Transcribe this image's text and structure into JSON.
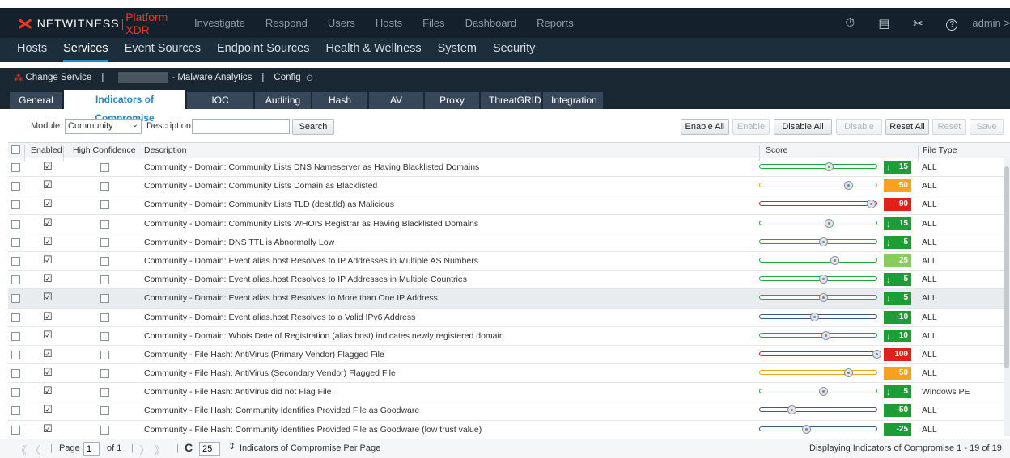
{
  "brand": {
    "name": "NETWITNESS",
    "separator": "|",
    "product": "Platform XDR"
  },
  "top_nav": [
    "Investigate",
    "Respond",
    "Users",
    "Hosts",
    "Files",
    "Dashboard",
    "Reports"
  ],
  "top_icons": {
    "timer": "⏱",
    "doc": "▤",
    "tools": "✂",
    "help": "?"
  },
  "admin_label": "admin >",
  "sec_nav": [
    "Hosts",
    "Services",
    "Event Sources",
    "Endpoint Sources",
    "Health & Wellness",
    "System",
    "Security"
  ],
  "service_bar": {
    "change_service": "Change Service",
    "pipe": "|",
    "service_name": "- Malware Analytics",
    "pipe2": "|",
    "config": "Config",
    "config_icon": "⊙"
  },
  "tabs": [
    "General",
    "Indicators of Compromise",
    "IOC Summary",
    "Auditing",
    "Hash",
    "AV",
    "Proxy",
    "ThreatGRID",
    "Integration"
  ],
  "toolbar": {
    "module_label": "Module",
    "module_value": "Community",
    "description_label": "Description",
    "description_value": "",
    "search": "Search",
    "enable_all": "Enable All",
    "enable": "Enable",
    "disable_all": "Disable All",
    "disable": "Disable",
    "reset_all": "Reset All",
    "reset": "Reset",
    "save": "Save"
  },
  "columns": {
    "enabled": "Enabled",
    "high_confidence": "High Confidence",
    "description": "Description",
    "score": "Score",
    "file_type": "File Type"
  },
  "colors": {
    "green": "#1fa83a",
    "light_green": "#8acc5c",
    "orange": "#f7a120",
    "red": "#e0201a",
    "dark_green": "#1d9d36"
  },
  "rows": [
    {
      "description": "Community - Domain: Community Lists DNS Nameserver as Having Blacklisted Domains",
      "score": 15,
      "score_text": "15",
      "arrow": "↓",
      "file_type": "ALL"
    },
    {
      "description": "Community - Domain: Community Lists Domain as Blacklisted",
      "score": 50,
      "score_text": "50",
      "arrow": "",
      "file_type": "ALL"
    },
    {
      "description": "Community - Domain: Community Lists TLD (dest.tld) as Malicious",
      "score": 90,
      "score_text": "90",
      "arrow": "",
      "file_type": "ALL"
    },
    {
      "description": "Community - Domain: Community Lists WHOIS Registrar as Having Blacklisted Domains",
      "score": 15,
      "score_text": "15",
      "arrow": "↓",
      "file_type": "ALL"
    },
    {
      "description": "Community - Domain: DNS TTL is Abnormally Low",
      "score": 5,
      "score_text": "5",
      "arrow": "↓",
      "file_type": "ALL"
    },
    {
      "description": "Community - Domain: Event alias.host Resolves to IP Addresses in Multiple AS Numbers",
      "score": 25,
      "score_text": "25",
      "arrow": "",
      "file_type": "ALL"
    },
    {
      "description": "Community - Domain: Event alias.host Resolves to IP Addresses in Multiple Countries",
      "score": 5,
      "score_text": "5",
      "arrow": "↓",
      "file_type": "ALL"
    },
    {
      "description": "Community - Domain: Event alias.host Resolves to More than One IP Address",
      "score": 5,
      "score_text": "5",
      "arrow": "↓",
      "file_type": "ALL"
    },
    {
      "description": "Community - Domain: Event alias.host Resolves to a Valid IPv6 Address",
      "score": -10,
      "score_text": "-10",
      "arrow": "",
      "file_type": "ALL"
    },
    {
      "description": "Community - Domain: Whois Date of Registration (alias.host) indicates newly registered domain",
      "score": 10,
      "score_text": "10",
      "arrow": "↓",
      "file_type": "ALL"
    },
    {
      "description": "Community - File Hash: AntiVirus (Primary Vendor) Flagged File",
      "score": 100,
      "score_text": "100",
      "arrow": "",
      "file_type": "ALL"
    },
    {
      "description": "Community - File Hash: AntiVirus (Secondary Vendor) Flagged File",
      "score": 50,
      "score_text": "50",
      "arrow": "",
      "file_type": "ALL"
    },
    {
      "description": "Community - File Hash: AntiVirus did not Flag File",
      "score": 5,
      "score_text": "5",
      "arrow": "↓",
      "file_type": "Windows PE"
    },
    {
      "description": "Community - File Hash: Community Identifies Provided File as Goodware",
      "score": -50,
      "score_text": "-50",
      "arrow": "",
      "file_type": "ALL"
    },
    {
      "description": "Community - File Hash: Community Identifies Provided File as Goodware (low trust value)",
      "score": -25,
      "score_text": "-25",
      "arrow": "",
      "file_type": "ALL"
    }
  ],
  "pager": {
    "page_label": "Page",
    "page_value": "1",
    "of_label": "of 1",
    "per_page_value": "25",
    "per_page_label": "Indicators of Compromise Per Page",
    "summary": "Displaying Indicators of Compromise 1 - 19 of 19",
    "first": "《",
    "prev": "〈",
    "next": "〉",
    "last": "》",
    "pipe": "|",
    "refresh": "C"
  }
}
